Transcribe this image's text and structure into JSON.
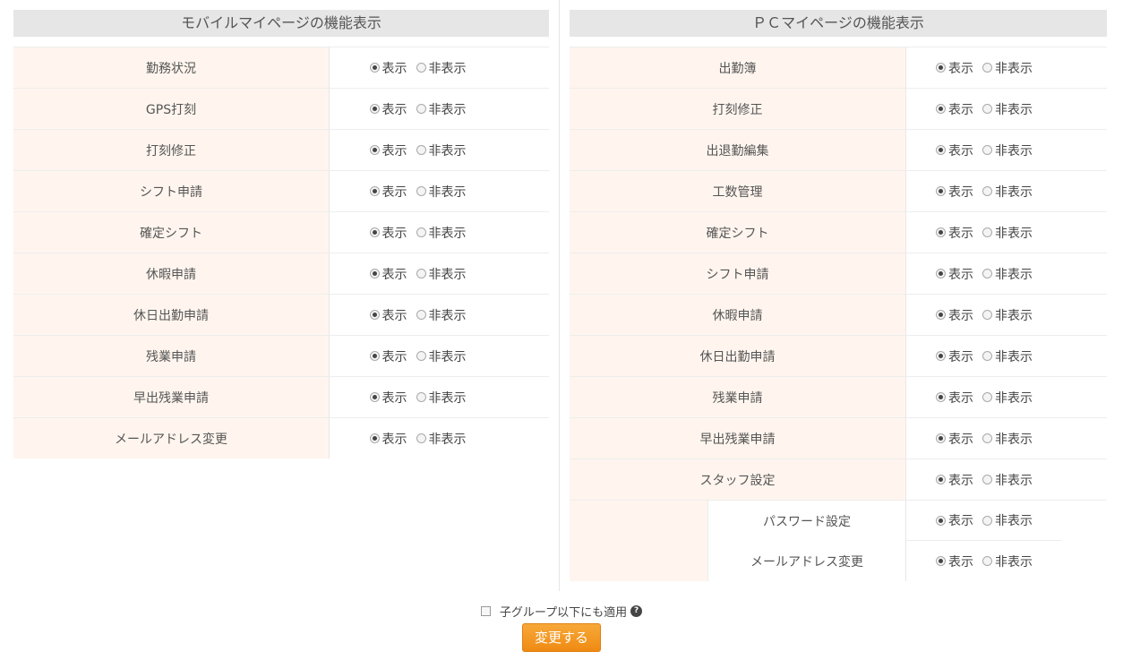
{
  "mobile": {
    "title": "モバイルマイページの機能表示",
    "show_label": "表示",
    "hide_label": "非表示",
    "rows": [
      {
        "label": "勤務状況",
        "selected": "show"
      },
      {
        "label": "GPS打刻",
        "selected": "show"
      },
      {
        "label": "打刻修正",
        "selected": "show"
      },
      {
        "label": "シフト申請",
        "selected": "show"
      },
      {
        "label": "確定シフト",
        "selected": "show"
      },
      {
        "label": "休暇申請",
        "selected": "show"
      },
      {
        "label": "休日出勤申請",
        "selected": "show"
      },
      {
        "label": "残業申請",
        "selected": "show"
      },
      {
        "label": "早出残業申請",
        "selected": "show"
      },
      {
        "label": "メールアドレス変更",
        "selected": "show"
      }
    ]
  },
  "pc": {
    "title": "ＰＣマイページの機能表示",
    "show_label": "表示",
    "hide_label": "非表示",
    "rows": [
      {
        "label": "出勤簿",
        "selected": "show",
        "sub": false
      },
      {
        "label": "打刻修正",
        "selected": "show",
        "sub": false
      },
      {
        "label": "出退勤編集",
        "selected": "show",
        "sub": false
      },
      {
        "label": "工数管理",
        "selected": "show",
        "sub": false
      },
      {
        "label": "確定シフト",
        "selected": "show",
        "sub": false
      },
      {
        "label": "シフト申請",
        "selected": "show",
        "sub": false
      },
      {
        "label": "休暇申請",
        "selected": "show",
        "sub": false
      },
      {
        "label": "休日出勤申請",
        "selected": "show",
        "sub": false
      },
      {
        "label": "残業申請",
        "selected": "show",
        "sub": false
      },
      {
        "label": "早出残業申請",
        "selected": "show",
        "sub": false
      },
      {
        "label": "スタッフ設定",
        "selected": "show",
        "sub": false
      },
      {
        "label": "パスワード設定",
        "selected": "show",
        "sub": true
      },
      {
        "label": "メールアドレス変更",
        "selected": "show",
        "sub": true
      }
    ]
  },
  "footer": {
    "apply_to_children_label": "子グループ以下にも適用",
    "apply_to_children_checked": false,
    "help_icon_glyph": "?",
    "submit_label": "変更する"
  },
  "colors": {
    "label_bg": "#fff5ee",
    "header_bg": "#e6e6e6",
    "button_orange": "#f29a20"
  }
}
